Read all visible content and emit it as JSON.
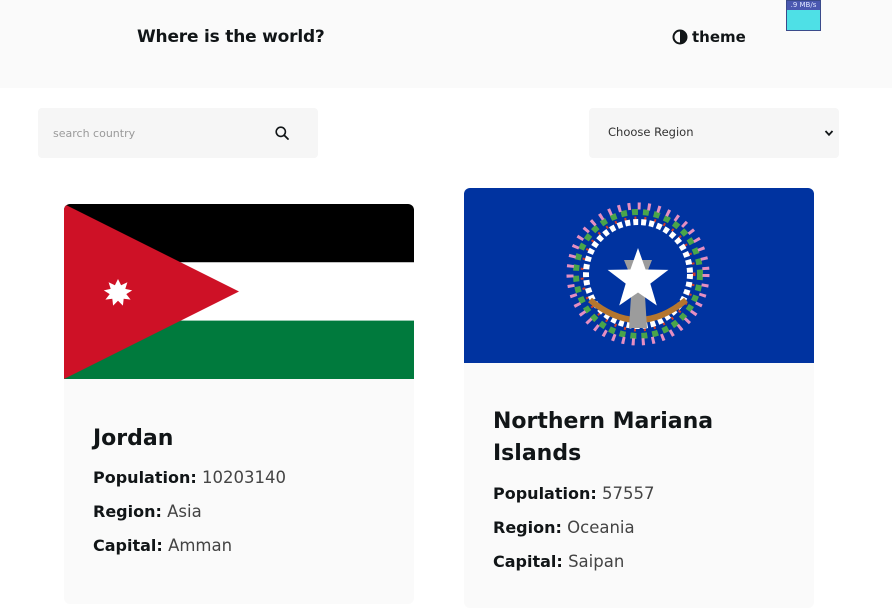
{
  "header": {
    "title": "Where is the world?",
    "theme_label": "theme",
    "net_widget_text": ".9 MB/s"
  },
  "search": {
    "placeholder": "search country",
    "value": ""
  },
  "filter": {
    "selected": "Choose Region"
  },
  "labels": {
    "population": "Population:",
    "region": "Region:",
    "capital": "Capital:"
  },
  "countries": [
    {
      "name": "Jordan",
      "population": "10203140",
      "region": "Asia",
      "capital": "Amman",
      "flag_icon": "flag-jordan"
    },
    {
      "name": "Northern Mariana Islands",
      "population": "57557",
      "region": "Oceania",
      "capital": "Saipan",
      "flag_icon": "flag-northern-mariana-islands"
    }
  ],
  "colors": {
    "header_bg": "#fafafa",
    "card_bg": "#fafafa",
    "text": "#111517",
    "jordan_red": "#ce1126",
    "jordan_green": "#007a3d",
    "nmi_blue": "#0033a0"
  }
}
